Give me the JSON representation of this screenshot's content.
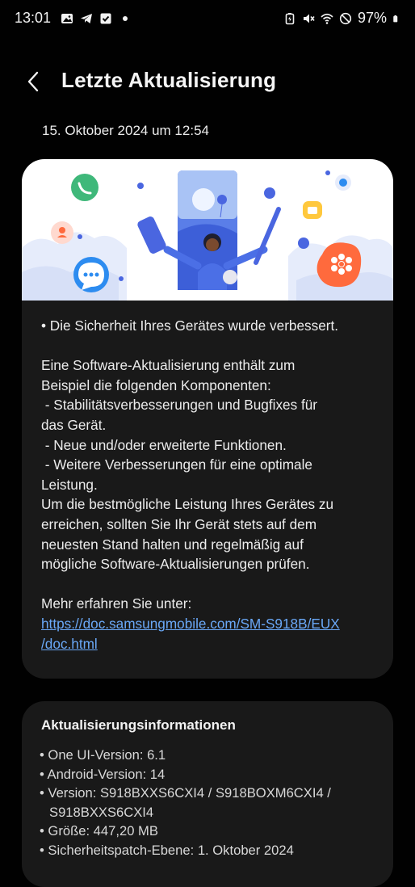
{
  "status_bar": {
    "time": "13:01",
    "left_icons": [
      "gallery-icon",
      "telegram-icon",
      "check-icon",
      "dot-icon"
    ],
    "right_icons": [
      "battery-saver-icon",
      "mute-icon",
      "wifi-icon",
      "dnd-icon",
      "battery-icon"
    ],
    "battery": "97%"
  },
  "header": {
    "title": "Letzte Aktualisierung",
    "back_icon": "chevron-left-icon"
  },
  "date": "15. Oktober 2024 um 12:54",
  "notes": {
    "l1": "• Die Sicherheit Ihres Gerätes wurde verbessert.",
    "l2": "Eine Software-Aktualisierung enthält zum",
    "l3": "Beispiel die folgenden Komponenten:",
    "l4": " - Stabilitätsverbesserungen und Bugfixes für",
    "l5": "das Gerät.",
    "l6": " - Neue und/oder erweiterte Funktionen.",
    "l7": " - Weitere Verbesserungen für eine optimale",
    "l8": "Leistung.",
    "l9": "Um die bestmögliche Leistung Ihres Gerätes zu",
    "l10": "erreichen, sollten Sie Ihr Gerät stets auf dem",
    "l11": "neuesten Stand halten und regelmäßig auf",
    "l12": "mögliche Software-Aktualisierungen prüfen.",
    "l13": "Mehr erfahren Sie unter:",
    "link1": "https://doc.samsungmobile.com/SM-S918B/EUX",
    "link2": "/doc.html"
  },
  "info": {
    "title": "Aktualisierungsinformationen",
    "i1": "• One UI-Version: 6.1",
    "i2": "• Android-Version: 14",
    "i3": "• Version: S918BXXS6CXI4 / S918BOXM6CXI4 /",
    "i3b": "S918BXXS6CXI4",
    "i4": "• Größe: 447,20 MB",
    "i5": "• Sicherheitspatch-Ebene: 1. Oktober 2024"
  },
  "colors": {
    "background": "#010101",
    "card": "#191919",
    "link": "#6aa8f7",
    "banner_blue": "#4a66e0",
    "banner_orange": "#ff6a3d",
    "banner_green": "#3fb87a"
  }
}
